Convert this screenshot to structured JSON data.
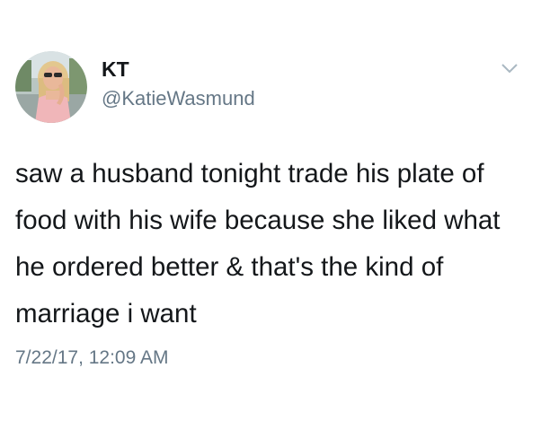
{
  "tweet": {
    "author": {
      "display_name": "KT",
      "handle": "@KatieWasmund"
    },
    "text": "saw a husband tonight trade his plate of food with his wife because she liked what he ordered better & that's the kind of marriage i want",
    "timestamp": "7/22/17, 12:09 AM",
    "menu_icon": "chevron-down-icon"
  },
  "colors": {
    "text_primary": "#14171a",
    "text_secondary": "#657786",
    "background": "#ffffff"
  }
}
